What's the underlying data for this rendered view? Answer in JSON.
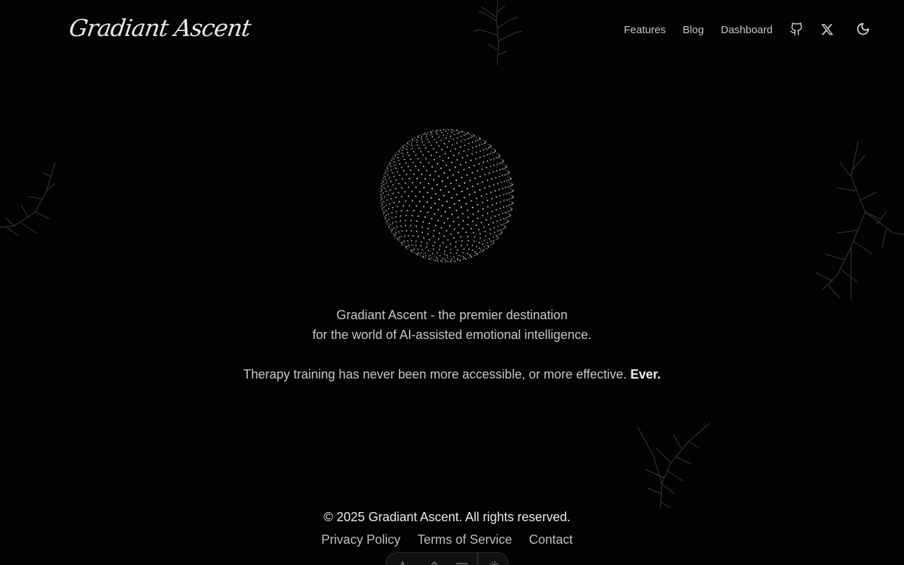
{
  "header": {
    "logo_text": "Gradiant Ascent",
    "nav": [
      {
        "label": "Features"
      },
      {
        "label": "Blog"
      },
      {
        "label": "Dashboard"
      }
    ],
    "icons": [
      "github-icon",
      "x-twitter-icon",
      "moon-icon"
    ]
  },
  "hero": {
    "line1": "Gradiant Ascent - the premier destination",
    "line2": "for the world of AI-assisted emotional intelligence.",
    "line3": "Therapy training has never been more accessible, or more effective.",
    "emphasis": "Ever."
  },
  "footer": {
    "copyright": "© 2025 Gradiant Ascent. All rights reserved.",
    "links": [
      {
        "label": "Privacy Policy"
      },
      {
        "label": "Terms of Service"
      },
      {
        "label": "Contact"
      }
    ]
  },
  "toolbar": {
    "icons": [
      "text-icon",
      "pen-icon",
      "menu-icon",
      "settings-icon"
    ]
  },
  "colors": {
    "background": "#030303",
    "text": "#c8c8c8",
    "sphere_dots": "#d8d8d8"
  }
}
